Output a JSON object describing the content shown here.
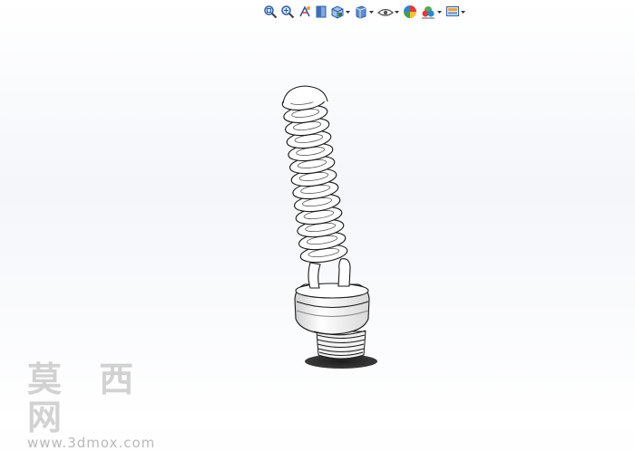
{
  "toolbar": {
    "items": [
      {
        "icon": "zoom-to-fit-icon",
        "has_menu": false
      },
      {
        "icon": "zoom-to-area-icon",
        "has_menu": false
      },
      {
        "icon": "previous-view-icon",
        "has_menu": false
      },
      {
        "icon": "section-view-icon",
        "has_menu": false
      },
      {
        "icon": "view-orientation-icon",
        "has_menu": true
      },
      {
        "icon": "display-style-icon",
        "has_menu": true
      },
      {
        "icon": "hide-show-items-icon",
        "has_menu": true
      },
      {
        "icon": "edit-appearance-icon",
        "has_menu": false
      },
      {
        "icon": "apply-scene-icon",
        "has_menu": true
      },
      {
        "icon": "view-settings-icon",
        "has_menu": true
      }
    ]
  },
  "watermark": {
    "chinese": "莫 西 网",
    "url": "www.3dmox.com"
  },
  "colors": {
    "toolbar_blue": "#2a5caa",
    "model_line": "#1a1a1a",
    "model_fill": "#ffffff",
    "shadow": "#2b2b2b"
  }
}
